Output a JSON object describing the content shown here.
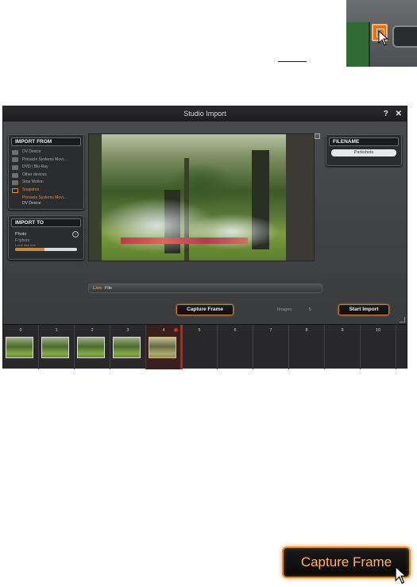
{
  "window": {
    "title": "Studio Import",
    "help_label": "?",
    "close_label": "✕"
  },
  "import_from": {
    "title": "IMPORT FROM",
    "items": [
      {
        "label": "DV Device",
        "icon": "camcorder-icon"
      },
      {
        "label": "Pinnacle Systems Movi...",
        "icon": "device-icon"
      },
      {
        "label": "DVD / Blu-Ray",
        "icon": "disc-icon"
      },
      {
        "label": "Other devices",
        "icon": "folder-icon"
      },
      {
        "label": "Stop Motion",
        "icon": "camera-icon"
      },
      {
        "label": "Snapshot",
        "icon": "snapshot-icon",
        "selected": true
      }
    ],
    "snapshot_sub": {
      "device": "Pinnacle Systems Movi...",
      "type": "DV Device"
    }
  },
  "import_to": {
    "title": "IMPORT TO",
    "category": "Photo",
    "path": "F:\\photo",
    "space": "Local disk free",
    "disk_fill_percent": 48
  },
  "filename": {
    "title": "FILENAME",
    "value": "Parkshots"
  },
  "source": {
    "live": "Live",
    "file": "File"
  },
  "controls": {
    "capture_label": "Capture Frame",
    "images_label": "Images:",
    "images_count": "5",
    "start_label": "Start Import"
  },
  "strip": {
    "frames": [
      "0",
      "1",
      "2",
      "3",
      "4",
      "5",
      "6",
      "7",
      "8",
      "9",
      "10"
    ],
    "filled_count": 5,
    "selected_index": 4
  },
  "zoom": {
    "capture_label": "Capture Frame"
  },
  "colors": {
    "accent": "#f08a24",
    "marker": "#c0241c",
    "window_bg": "#3b3c3e"
  }
}
